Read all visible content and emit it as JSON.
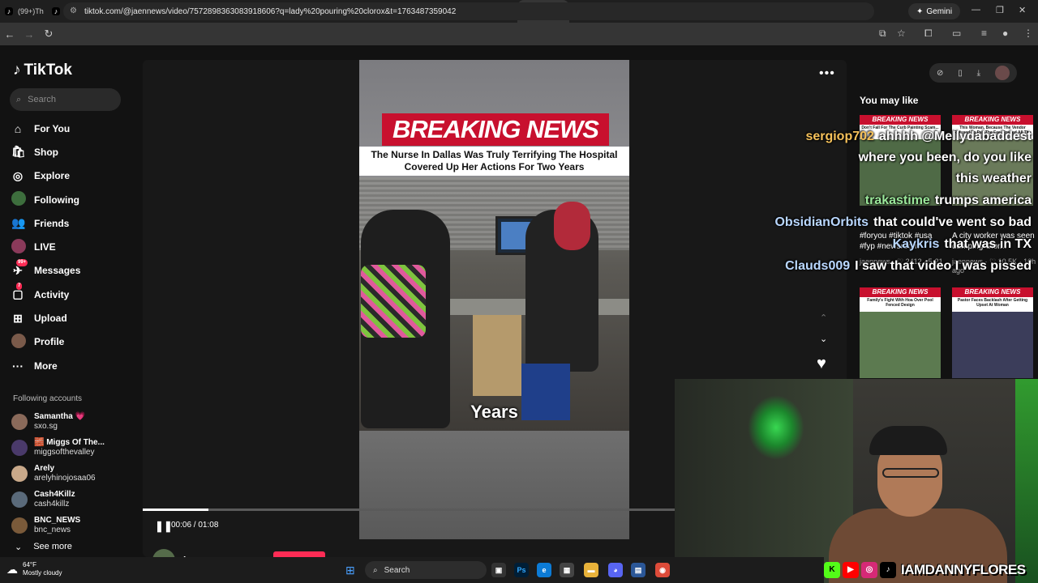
{
  "browser": {
    "tabs": [
      {
        "icon": "tiktok-icon",
        "label": "(99+)Th"
      },
      {
        "icon": "tiktok-icon",
        "label": "(99+)Je"
      },
      {
        "icon": "tiktok-icon",
        "label": "(99+)Im"
      },
      {
        "icon": "tiktok-icon",
        "label": "(99+)11"
      },
      {
        "icon": "tiktok-icon",
        "label": "(99+)Di"
      },
      {
        "icon": "tiktok-icon",
        "label": "(99+)U"
      },
      {
        "icon": "instagram-icon",
        "label": "(2) Inst"
      },
      {
        "icon": "search-icon",
        "label": "Find 'p"
      },
      {
        "icon": "tiktok-icon",
        "label": "(99+)#"
      },
      {
        "icon": "instagram-icon",
        "label": "(2) Inst"
      },
      {
        "icon": "tiktok-icon",
        "label": "(99+)Te"
      },
      {
        "icon": "tiktok-icon",
        "label": ""
      },
      {
        "icon": "tiktok-icon",
        "label": "(99+)H"
      },
      {
        "icon": "instagram-icon",
        "label": "(2) Inst"
      },
      {
        "icon": "tiktok-icon",
        "label": "(99+)A"
      },
      {
        "icon": "tiktok-icon",
        "label": "(99+)Th"
      },
      {
        "icon": "tiktok-icon",
        "label": "(99+)Tr"
      },
      {
        "icon": "tiktok-icon",
        "label": "(99+)O"
      }
    ],
    "gemini_label": "Gemini",
    "url": "tiktok.com/@jaennews/video/7572898363083918606?q=lady%20pouring%20clorox&t=1763487359042"
  },
  "sidebar": {
    "logo": "TikTok",
    "search_placeholder": "Search",
    "nav": [
      {
        "icon": "home-icon",
        "glyph": "⌂",
        "label": "For You"
      },
      {
        "icon": "shop-icon",
        "glyph": "🛍",
        "label": "Shop"
      },
      {
        "icon": "compass-icon",
        "glyph": "◎",
        "label": "Explore"
      },
      {
        "icon": "avatar",
        "glyph": "",
        "label": "Following"
      },
      {
        "icon": "friends-icon",
        "glyph": "👥",
        "label": "Friends"
      },
      {
        "icon": "live-avatar",
        "glyph": "",
        "label": "LIVE"
      },
      {
        "icon": "messages-icon",
        "glyph": "✈",
        "label": "Messages",
        "badge": "99+"
      },
      {
        "icon": "activity-icon",
        "glyph": "▢",
        "label": "Activity",
        "badge": "7"
      },
      {
        "icon": "upload-icon",
        "glyph": "⊞",
        "label": "Upload"
      },
      {
        "icon": "profile-avatar",
        "glyph": "",
        "label": "Profile"
      },
      {
        "icon": "more-icon",
        "glyph": "···",
        "label": "More"
      }
    ],
    "following_title": "Following accounts",
    "following": [
      {
        "name": "Samantha 💗",
        "handle": "sxo.sg"
      },
      {
        "name": "🧱 Miggs Of The...",
        "handle": "miggsofthevalley"
      },
      {
        "name": "Arely",
        "handle": "arelyhinojosaa06"
      },
      {
        "name": "Cash4Killz",
        "handle": "cash4killz"
      },
      {
        "name": "BNC_NEWS",
        "handle": "bnc_news"
      }
    ],
    "see_more": "See more"
  },
  "video": {
    "banner": "BREAKING NEWS",
    "headline": "The Nurse In Dallas Was Truly Terrifying The Hospital Covered Up Her Actions For Two Years",
    "caption": "Years",
    "time": "00:06 / 01:08",
    "progress": 0.124,
    "author": "jaennews"
  },
  "right": {
    "you_may_like": "You may like",
    "thumbs": [
      {
        "sub": "Don't Fall For The Curb Painting Scam..."
      },
      {
        "sub": "This Woman, Because The Vendor Refused To Pay The Fee, Poured All The Bleach..."
      },
      {
        "sub": "Family's Fight With Hoa Over Pool Fenced Design"
      },
      {
        "sub": "Pastor Faces Backlash After Getting Upset At Woman"
      }
    ],
    "captions": [
      {
        "text": "#foryou #tiktok #usa #fyp #newsroom",
        "meta": "jaennews · ♡ 2412 · 5-21"
      },
      {
        "text": "A city worker was seen dumping Clor...",
        "meta": "jaennews · ♡ 10.5K · 10h ago"
      }
    ]
  },
  "chat": [
    {
      "user": "sergiop702",
      "color": "#f5c15a",
      "msg": "ahhhh @Mellydabaddest"
    },
    {
      "user": "",
      "color": "#ffffff",
      "msg": "where you been, do you like"
    },
    {
      "user": "",
      "color": "#ffffff",
      "msg": "this weather"
    },
    {
      "user": "trakastime",
      "color": "#9be89b",
      "msg": "trumps america"
    },
    {
      "user": "ObsidianOrbits",
      "color": "#b9d7ff",
      "msg": "that could've went so bad"
    },
    {
      "user": "Kaykris",
      "color": "#b9d7ff",
      "msg": "that was in TX"
    },
    {
      "user": "Clauds009",
      "color": "#b9d7ff",
      "msg": "I saw that video I was pissed"
    }
  ],
  "stream": {
    "handle": "IAMDANNYFLORES"
  },
  "taskbar": {
    "temp": "64°F",
    "weather": "Mostly cloudy",
    "search": "Search"
  },
  "colors": {
    "accent": "#fe2c55",
    "breaking": "#c8102e"
  }
}
